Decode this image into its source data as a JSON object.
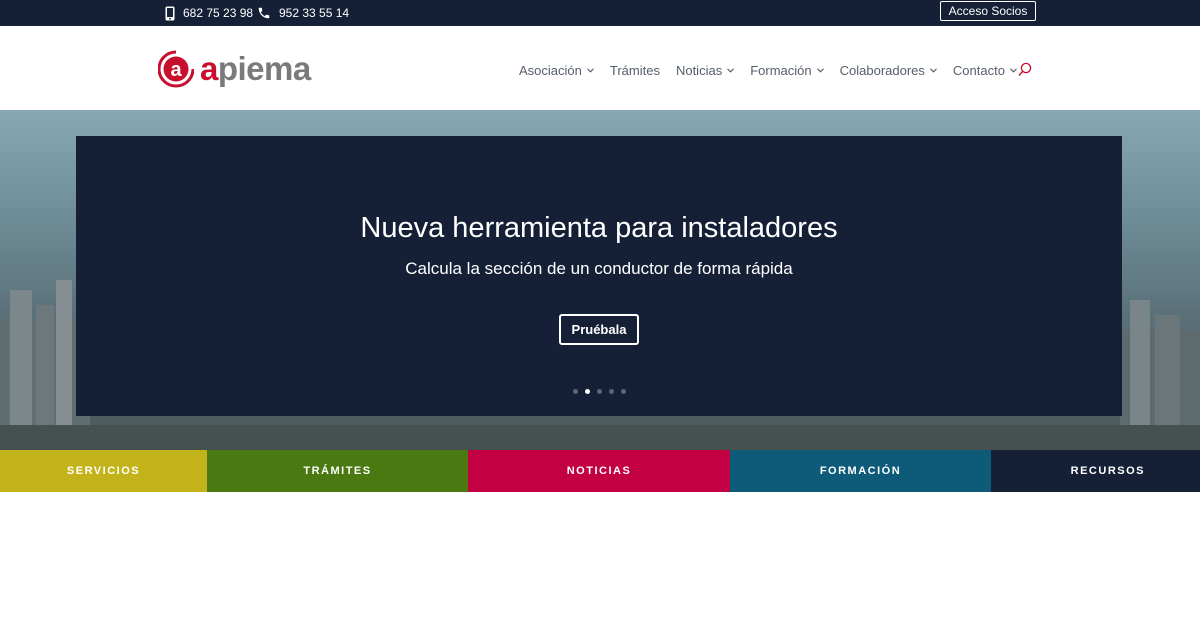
{
  "topbar": {
    "phone_mobile": "682 75 23 98",
    "phone_landline": "952 33 55 14",
    "access_button": "Acceso Socios"
  },
  "header": {
    "logo": {
      "text_first": "a",
      "text_rest": "piema",
      "icon": "apiema-logo-icon"
    },
    "nav": [
      {
        "label": "Asociación",
        "dropdown": true
      },
      {
        "label": "Trámites",
        "dropdown": false
      },
      {
        "label": "Noticias",
        "dropdown": true
      },
      {
        "label": "Formación",
        "dropdown": true
      },
      {
        "label": "Colaboradores",
        "dropdown": true
      },
      {
        "label": "Contacto",
        "dropdown": true
      }
    ],
    "search_icon": "search-icon"
  },
  "hero": {
    "title": "Nueva herramienta para instaladores",
    "subtitle": "Calcula la sección de un conductor de forma rápida",
    "button": "Pruébala",
    "slides_count": 5,
    "active_slide": 2
  },
  "categories": [
    {
      "label": "SERVICIOS",
      "color": "#c3b31b"
    },
    {
      "label": "TRÁMITES",
      "color": "#4a7811"
    },
    {
      "label": "NOTICIAS",
      "color": "#c30042"
    },
    {
      "label": "FORMACIÓN",
      "color": "#0d5a79"
    },
    {
      "label": "RECURSOS",
      "color": "#152036"
    }
  ],
  "colors": {
    "navy": "#152036",
    "brand_red": "#c8102e",
    "nav_text": "#555e6b"
  }
}
